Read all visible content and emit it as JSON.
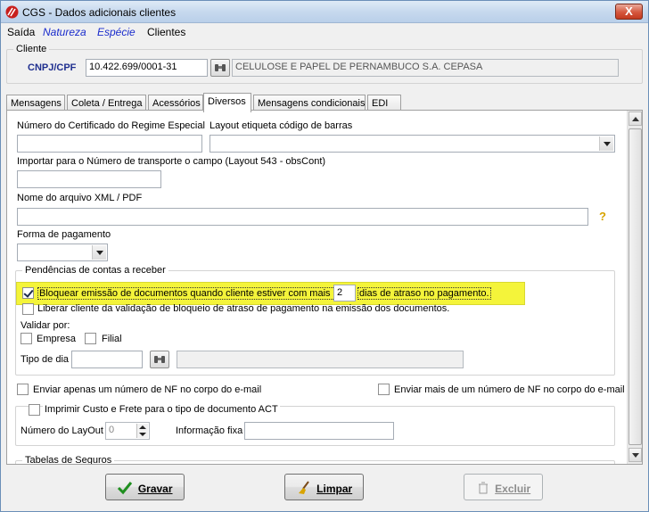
{
  "window": {
    "title": "CGS - Dados adicionais clientes",
    "close_glyph": "X"
  },
  "menu": [
    "Saída",
    "Natureza",
    "Espécie",
    "Clientes"
  ],
  "cliente": {
    "legend": "Cliente",
    "cnpj_label": "CNPJ/CPF",
    "cnpj_value": "10.422.699/0001-31",
    "nome_value": "CELULOSE E PAPEL DE PERNAMBUCO S.A. CEPASA"
  },
  "tabs": [
    {
      "label": "Mensagens",
      "active": false
    },
    {
      "label": "Coleta / Entrega",
      "active": false
    },
    {
      "label": "Acessórios",
      "active": false
    },
    {
      "label": "Diversos",
      "active": true
    },
    {
      "label": "Mensagens condicionais",
      "active": false
    },
    {
      "label": "EDI",
      "active": false
    }
  ],
  "diversos": {
    "certificado_label": "Número do Certificado do Regime Especial",
    "certificado_value": "",
    "layout_label": "Layout etiqueta código de barras",
    "layout_value": "",
    "importar_label": "Importar para o Número de transporte o campo (Layout 543 - obsCont)",
    "importar_value": "",
    "xml_label": "Nome do arquivo XML / PDF",
    "xml_value": "",
    "help_glyph": "?",
    "forma_label": "Forma de pagamento",
    "forma_value": "",
    "pendencias": {
      "legend": "Pendências de contas a receber",
      "bloquear_prefix": "Bloquear emissão de documentos quando cliente estiver com mais de",
      "bloquear_dias": "2",
      "bloquear_suffix": "dias de atraso no pagamento.",
      "bloquear_checked": true,
      "liberar_label": "Liberar cliente da validação de bloqueio de atraso de pagamento na emissão dos documentos.",
      "liberar_checked": false,
      "validar_label": "Validar por:",
      "empresa_label": "Empresa",
      "filial_label": "Filial",
      "tipo_dia_label": "Tipo de dia",
      "tipo_dia_value": "",
      "tipo_dia_desc": ""
    },
    "enviar_apenas_label": "Enviar apenas um número de NF no corpo do e-mail",
    "enviar_mais_label": "Enviar mais de um número de NF no corpo do e-mail",
    "imprimir_label": "Imprimir Custo e Frete para o tipo de documento ACT",
    "numero_layout_label": "Número do LayOut",
    "numero_layout_value": "0",
    "informacao_fixa_label": "Informação fixa",
    "informacao_fixa_value": "",
    "tabelas_legend": "Tabelas de Seguros"
  },
  "buttons": {
    "gravar": "Gravar",
    "limpar": "Limpar",
    "excluir": "Excluir"
  },
  "colors": {
    "highlight": "#f4f43a",
    "menu_italic": "#1a2ccc",
    "cnpj_label": "#1f2f8f"
  }
}
